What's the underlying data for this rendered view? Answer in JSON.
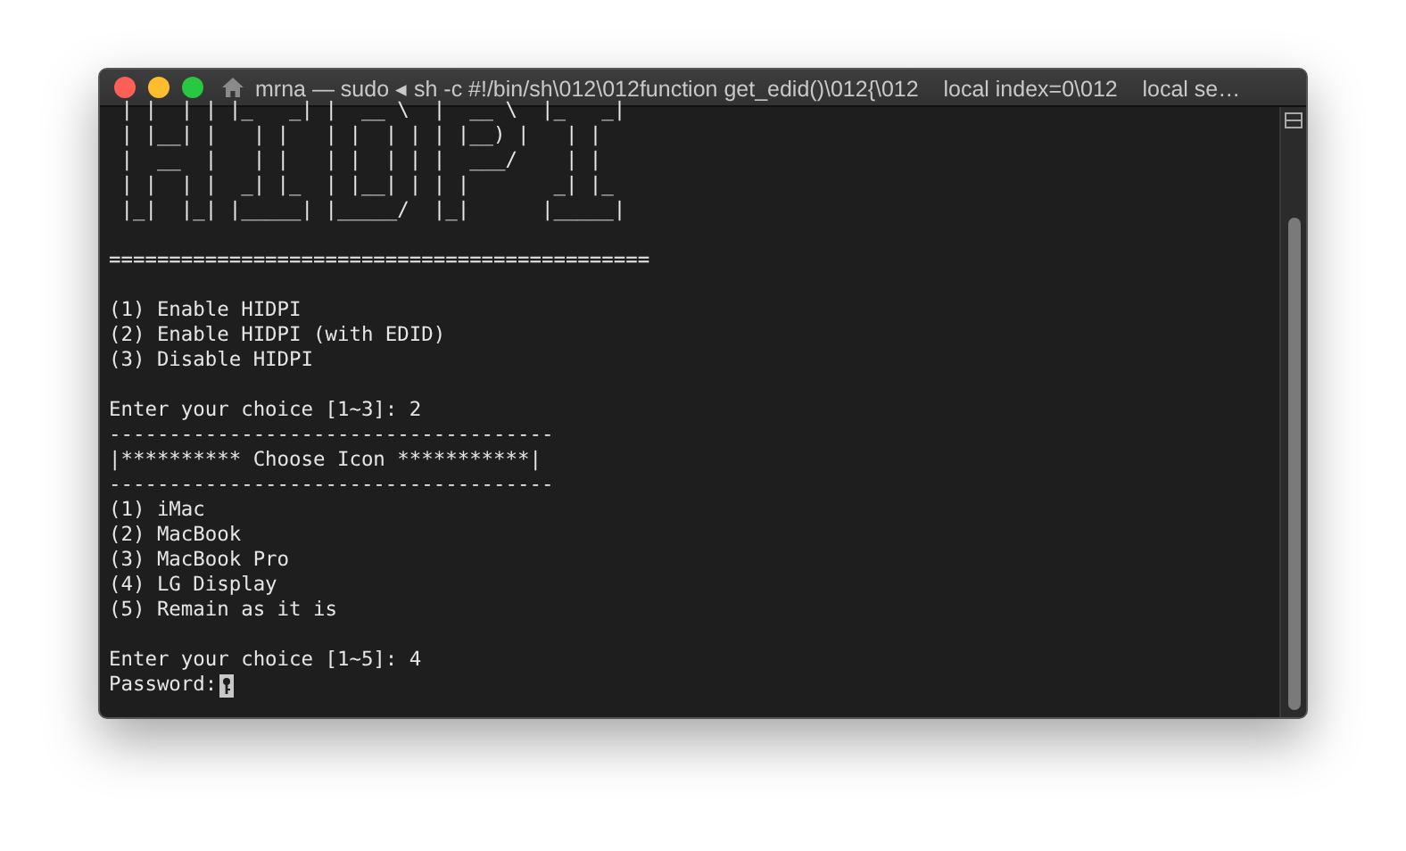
{
  "window": {
    "title": "mrna — sudo ◂ sh -c #!/bin/sh\\012\\012function get_edid()\\012{\\012    local index=0\\012    local se…"
  },
  "lines": [
    {
      "kind": "text",
      "text": " | |  | | |_   _| |  __ \\  |  __ \\  |_   _|"
    },
    {
      "kind": "text",
      "text": " | |__| |   | |   | |  | | | |__) |   | |"
    },
    {
      "kind": "text",
      "text": " |  __  |   | |   | |  | | |  ___/    | |"
    },
    {
      "kind": "text",
      "text": " | |  | |  _| |_  | |__| | | |       _| |_"
    },
    {
      "kind": "text",
      "text": " |_|  |_| |_____| |_____/  |_|      |_____|"
    },
    {
      "kind": "blank"
    },
    {
      "kind": "text",
      "text": "============================================="
    },
    {
      "kind": "blank"
    },
    {
      "kind": "text",
      "text": "(1) Enable HIDPI"
    },
    {
      "kind": "text",
      "text": "(2) Enable HIDPI (with EDID)"
    },
    {
      "kind": "text",
      "text": "(3) Disable HIDPI"
    },
    {
      "kind": "blank"
    },
    {
      "kind": "text",
      "text": "Enter your choice [1~3]: 2"
    },
    {
      "kind": "text",
      "text": "-------------------------------------"
    },
    {
      "kind": "text",
      "text": "|********** Choose Icon ***********|"
    },
    {
      "kind": "text",
      "text": "-------------------------------------"
    },
    {
      "kind": "text",
      "text": "(1) iMac"
    },
    {
      "kind": "text",
      "text": "(2) MacBook"
    },
    {
      "kind": "text",
      "text": "(3) MacBook Pro"
    },
    {
      "kind": "text",
      "text": "(4) LG Display"
    },
    {
      "kind": "text",
      "text": "(5) Remain as it is"
    },
    {
      "kind": "blank"
    },
    {
      "kind": "text",
      "text": "Enter your choice [1~5]: 4"
    },
    {
      "kind": "prompt",
      "text": "Password:"
    }
  ]
}
